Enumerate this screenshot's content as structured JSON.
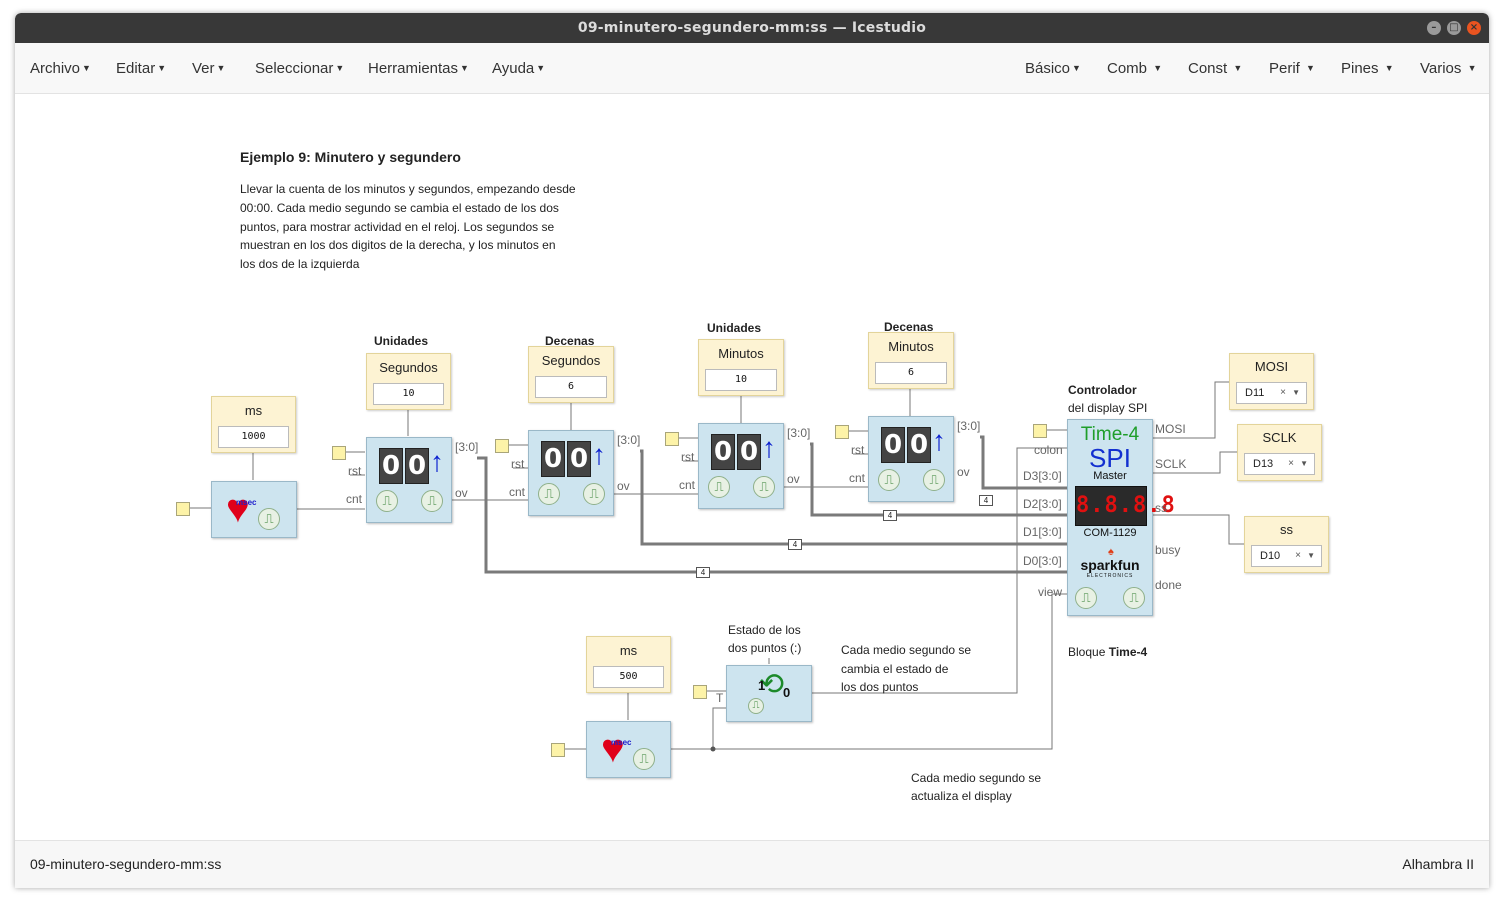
{
  "window": {
    "title": "09-minutero-segundero-mm:ss — Icestudio"
  },
  "menu_left": [
    "Archivo",
    "Editar",
    "Ver",
    "Seleccionar",
    "Herramientas",
    "Ayuda"
  ],
  "menu_right": [
    "Básico",
    "Comb",
    "Const",
    "Perif",
    "Pines",
    "Varios"
  ],
  "description": {
    "title": "Ejemplo 9: Minutero y segundero",
    "lines": [
      "Llevar la cuenta de los minutos y segundos, empezando desde",
      "00:00. Cada medio segundo se cambia el estado de los dos",
      "puntos, para mostrar actividad en el reloj. Los segundos se",
      "muestran en los dos digitos de la derecha, y los minutos en",
      "los dos de la izquierda"
    ]
  },
  "headings": {
    "unidades_seg": "Unidades",
    "decenas_seg": "Decenas",
    "unidades_min": "Unidades",
    "decenas_min": "Decenas"
  },
  "constants": {
    "ms1": {
      "label": "ms",
      "value": "1000"
    },
    "seg_u": {
      "label": "Segundos",
      "value": "10"
    },
    "seg_d": {
      "label": "Segundos",
      "value": "6"
    },
    "min_u": {
      "label": "Minutos",
      "value": "10"
    },
    "min_d": {
      "label": "Minutos",
      "value": "6"
    },
    "ms2": {
      "label": "ms",
      "value": "500"
    }
  },
  "counter": {
    "digits": "0",
    "rst": "rst",
    "cnt": "cnt",
    "bus_out": "[3:0]",
    "ov": "ov"
  },
  "heartbeat": {
    "badge": "msec"
  },
  "bus_width": "4",
  "controller": {
    "title_line1": "Controlador",
    "title_line2": "del display SPI",
    "block_title": "Time-4",
    "block_spi": "SPI",
    "block_master": "Master",
    "block_part": "COM-1129",
    "block_brand": "sparkfun",
    "block_brand_sub": "ELECTRONICS",
    "display_text": "8.8.8.8",
    "inputs": [
      "colon",
      "D3[3:0]",
      "D2[3:0]",
      "D1[3:0]",
      "D0[3:0]",
      "view"
    ],
    "outputs": [
      "MOSI",
      "SCLK",
      "ss",
      "busy",
      "done"
    ],
    "caption_prefix": "Bloque ",
    "caption_bold": "Time-4"
  },
  "pins": {
    "mosi": {
      "label": "MOSI",
      "value": "D11"
    },
    "sclk": {
      "label": "SCLK",
      "value": "D13"
    },
    "ss": {
      "label": "ss",
      "value": "D10"
    },
    "clear": "×"
  },
  "toggle": {
    "comment_line1": "Estado de los",
    "comment_line2": "dos puntos (:)",
    "t_port": "T",
    "one": "1",
    "zero": "0"
  },
  "comments": {
    "colon": [
      "Cada medio segundo se",
      "cambia el estado de",
      "los dos puntos"
    ],
    "view": [
      "Cada medio segundo se",
      "actualiza el display"
    ]
  },
  "footer": {
    "filename": "09-minutero-segundero-mm:ss",
    "board": "Alhambra II"
  },
  "colors": {
    "titlebar": "#383838",
    "block": "#cde4ef",
    "constant": "#fdf3d3",
    "close": "#e95420"
  }
}
